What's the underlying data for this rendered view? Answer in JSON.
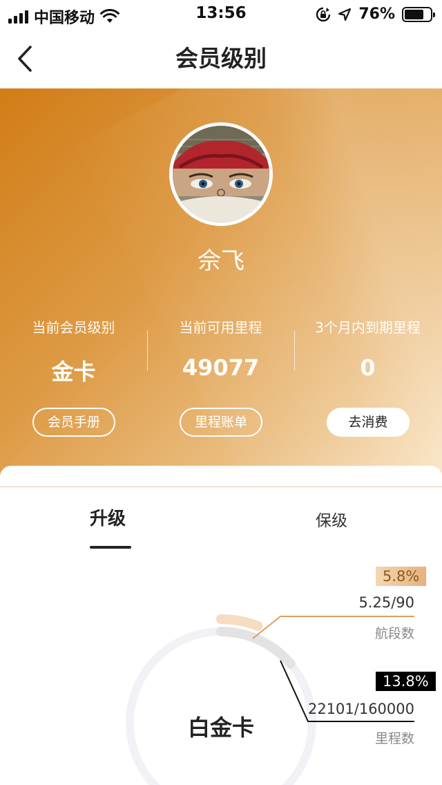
{
  "status_bar": {
    "carrier": "中国移动",
    "time": "13:56",
    "battery_percent": "76%",
    "battery_level": 0.76,
    "icons": [
      "signal-icon",
      "wifi-icon",
      "rotation-lock-icon",
      "location-arrow-icon",
      "battery-icon"
    ]
  },
  "nav": {
    "title": "会员级别",
    "back_icon": "chevron-left-icon"
  },
  "profile": {
    "name": "佘飞"
  },
  "stats": [
    {
      "label": "当前会员级别",
      "value": "金卡"
    },
    {
      "label": "当前可用里程",
      "value": "49077"
    },
    {
      "label": "3个月内到期里程",
      "value": "0"
    }
  ],
  "actions": {
    "handbook": "会员手册",
    "mileage_bill": "里程账单",
    "spend": "去消费"
  },
  "tabs": {
    "upgrade": "升级",
    "maintain": "保级"
  },
  "progress": {
    "target_level": "白金卡",
    "segments": {
      "percent": "5.8%",
      "fraction": "5.25/90",
      "label": "航段数",
      "ratio": 0.058
    },
    "mileage": {
      "percent": "13.8%",
      "fraction": "22101/160000",
      "label": "里程数",
      "ratio": 0.138
    }
  },
  "colors": {
    "hero_start": "#d17d17",
    "hero_end": "#f9e3c0",
    "segments_arc": "#f6dcc0",
    "mileage_arc": "#e3e3e6",
    "ring_track": "#f1f2f5",
    "segments_leader": "#d9a05a",
    "mileage_leader": "#111111"
  }
}
